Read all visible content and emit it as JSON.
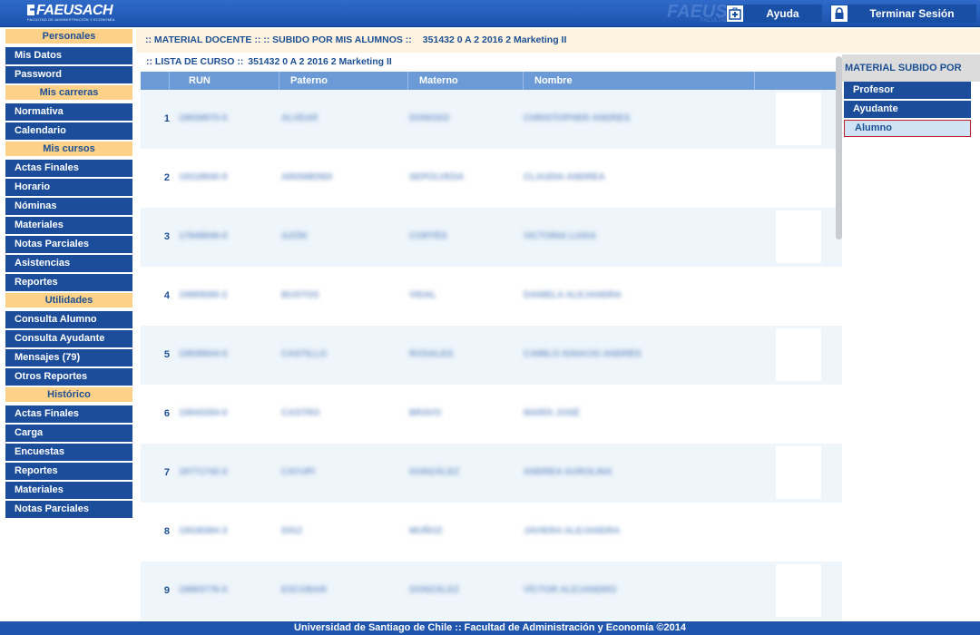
{
  "header": {
    "logo_text": "FAEUSACH",
    "logo_subtitle": "FACULTAD DE ADMINISTRACIÓN Y ECONOMÍA",
    "help_label": "Ayuda",
    "logout_label": "Terminar Sesión",
    "help_icon": "first-aid-kit-icon",
    "logout_icon": "lock-icon"
  },
  "sidebar": {
    "sections": [
      {
        "title": "Personales",
        "items": [
          "Mis Datos",
          "Password"
        ]
      },
      {
        "title": "Mis carreras",
        "items": [
          "Normativa",
          "Calendario"
        ]
      },
      {
        "title": "Mis cursos",
        "items": [
          "Actas Finales",
          "Horario",
          "Nóminas",
          "Materiales",
          "Notas Parciales",
          "Asistencias",
          "Reportes"
        ]
      },
      {
        "title": "Utilidades",
        "items": [
          "Consulta Alumno",
          "Consulta Ayudante",
          "Mensajes (79)",
          "Otros Reportes"
        ]
      },
      {
        "title": "Histórico",
        "items": [
          "Actas Finales",
          "Carga",
          "Encuestas",
          "Reportes",
          "Materiales",
          "Notas Parciales"
        ]
      }
    ]
  },
  "breadcrumb": {
    "path": ":: MATERIAL DOCENTE :: :: SUBIDO POR MIS ALUMNOS ::",
    "course": "351432 0 A 2 2016 2 Marketing II"
  },
  "list": {
    "title": ":: LISTA DE CURSO ::",
    "course": "351432 0 A 2 2016 2 Marketing II",
    "columns": [
      "RUN",
      "Paterno",
      "Materno",
      "Nombre"
    ],
    "rows": [
      {
        "num": "1",
        "run": "19839870-0",
        "paterno": "ALVEAR",
        "materno": "DONOSO",
        "nombre": "CHRISTOPHER ANDRES"
      },
      {
        "num": "2",
        "run": "19318840-9",
        "paterno": "ARISMENDI",
        "materno": "SEPÚLVEDA",
        "nombre": "CLAUDIA ANDREA"
      },
      {
        "num": "3",
        "run": "17848849-0",
        "paterno": "AZÓN",
        "materno": "CORTÉS",
        "nombre": "VICTORIA LUISA"
      },
      {
        "num": "4",
        "run": "19889580-2",
        "paterno": "BUSTOS",
        "materno": "VIDAL",
        "nombre": "DANIELA ALEJANDRA"
      },
      {
        "num": "5",
        "run": "19838944-0",
        "paterno": "CASTILLO",
        "materno": "ROSALES",
        "nombre": "CAMILO IGNACIO ANDRÉS"
      },
      {
        "num": "6",
        "run": "19840284-0",
        "paterno": "CASTRO",
        "materno": "BRAVO",
        "nombre": "MARÍA JOSÉ"
      },
      {
        "num": "7",
        "run": "18771742-0",
        "paterno": "CAYUPI",
        "materno": "GONZÁLEZ",
        "nombre": "ANDREA AUROLINA"
      },
      {
        "num": "8",
        "run": "19538384-3",
        "paterno": "DÍAZ",
        "materno": "MUÑOZ",
        "nombre": "JAVIERA ALEJANDRA"
      },
      {
        "num": "9",
        "run": "19883776-0",
        "paterno": "ESCOBAR",
        "materno": "GONZÁLEZ",
        "nombre": "VÍCTOR ALEJANDRO"
      }
    ]
  },
  "right_panel": {
    "title": "MATERIAL SUBIDO POR",
    "items": [
      "Profesor",
      "Ayudante",
      "Alumno"
    ],
    "active": "Alumno"
  },
  "footer": {
    "text": "Universidad de Santiago de Chile :: Facultad de Administración y Economía ©2014"
  }
}
